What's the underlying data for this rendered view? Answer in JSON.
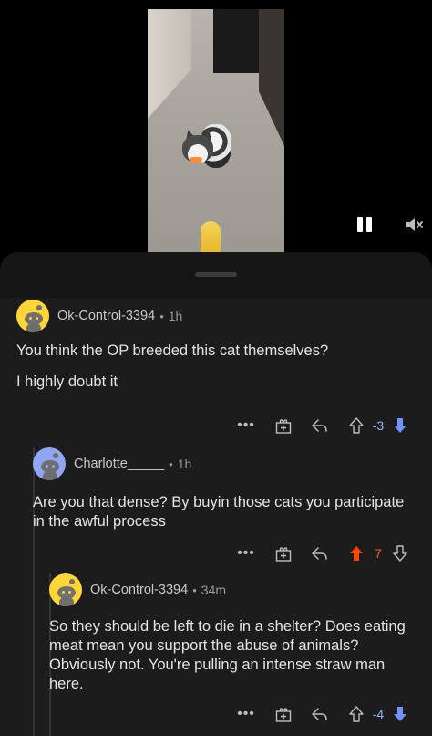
{
  "video": {
    "pause_icon": "pause-icon",
    "mute_icon": "muted-speaker-icon"
  },
  "comments": [
    {
      "username": "Ok-Control-3394",
      "separator": "•",
      "time": "1h",
      "body": [
        "You think the OP breeded this cat themselves?",
        "I highly doubt it"
      ],
      "more": "•••",
      "score": "-3",
      "vote_state": "downvoted",
      "avatar_color": "#ffd635"
    },
    {
      "username": "Charlotte_____",
      "separator": "•",
      "time": "1h",
      "body": [
        "Are you that dense? By buyin those cats you participate in the awful process"
      ],
      "more": "•••",
      "score": "7",
      "vote_state": "upvoted",
      "avatar_color": "#8fa6f6"
    },
    {
      "username": "Ok-Control-3394",
      "separator": "•",
      "time": "34m",
      "body": [
        "So they should be left to die in a shelter? Does eating meat mean you support the abuse of animals? Obviously not. You're pulling an intense straw man here."
      ],
      "more": "•••",
      "score": "-4",
      "vote_state": "downvoted",
      "avatar_color": "#ffd635"
    }
  ],
  "colors": {
    "upvote": "#ff4500",
    "downvote": "#7193ff",
    "background": "#1c1c1c"
  }
}
